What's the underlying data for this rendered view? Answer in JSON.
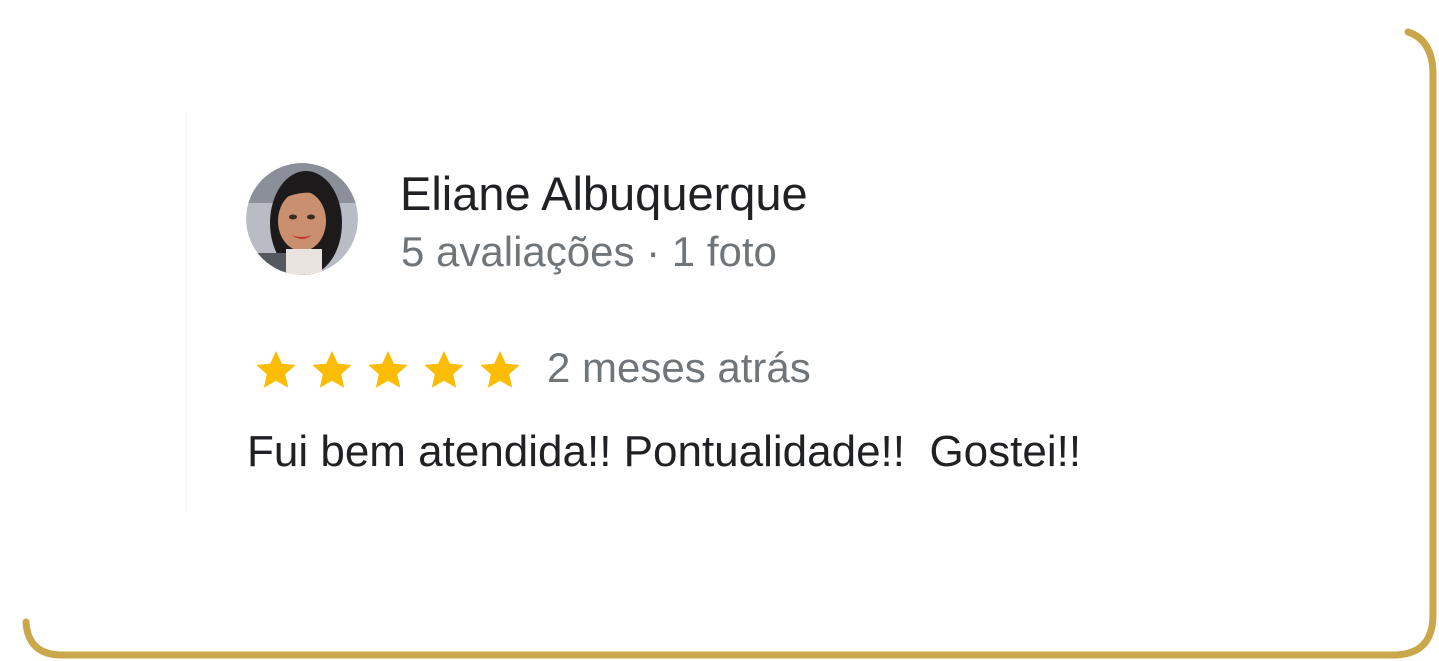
{
  "colors": {
    "border": "#c9a74a",
    "star": "#fbbc04",
    "name_text": "#202124",
    "meta_text": "#70757a"
  },
  "review": {
    "reviewer_name": "Eliane Albuquerque",
    "reviewer_meta": "5 avaliações · 1 foto",
    "rating": 5,
    "rating_max": 5,
    "time_ago": "2 meses atrás",
    "text": "Fui bem atendida!! Pontualidade!!  Gostei!!"
  },
  "avatar": {
    "icon": "user-photo-avatar"
  }
}
